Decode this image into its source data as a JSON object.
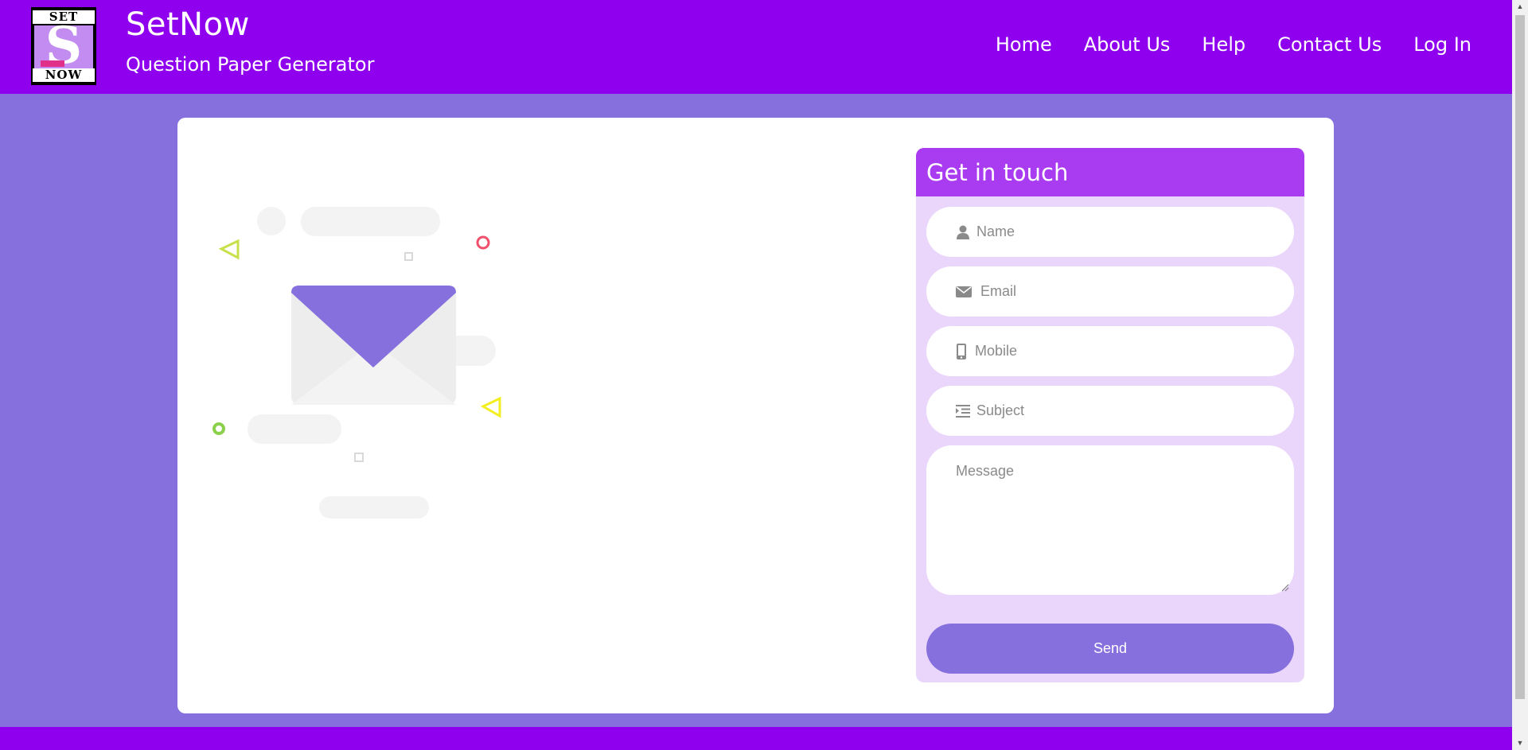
{
  "header": {
    "logo": {
      "top_text": "SET",
      "letter": "S",
      "bottom_text": "NOW"
    },
    "title": "SetNow",
    "subtitle": "Question Paper Generator",
    "nav": [
      {
        "label": "Home"
      },
      {
        "label": "About Us"
      },
      {
        "label": "Help"
      },
      {
        "label": "Contact Us"
      },
      {
        "label": "Log In"
      }
    ]
  },
  "contact_form": {
    "heading": "Get in touch",
    "fields": {
      "name": {
        "placeholder": "Name",
        "value": "",
        "icon": "user-icon"
      },
      "email": {
        "placeholder": "Email",
        "value": "",
        "icon": "envelope-icon"
      },
      "mobile": {
        "placeholder": "Mobile",
        "value": "",
        "icon": "mobile-phone-icon"
      },
      "subject": {
        "placeholder": "Subject",
        "value": "",
        "icon": "indent-icon"
      },
      "message": {
        "placeholder": "Message",
        "value": ""
      }
    },
    "send_label": "Send"
  },
  "colors": {
    "header_bg": "#8f00ef",
    "page_bg": "#8670dd",
    "form_header_bg": "#a93bf0",
    "form_panel_bg": "#ead6fb",
    "button_bg": "#8670dd"
  }
}
